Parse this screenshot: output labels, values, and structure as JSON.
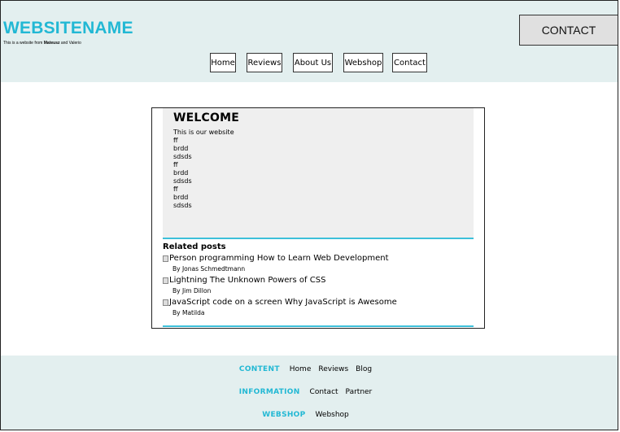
{
  "header": {
    "title": "WEBSITENAME",
    "subtitle_prefix": "This is a website from ",
    "subtitle_name1": "Mateusz",
    "subtitle_mid": " and ",
    "subtitle_name2": "Valerio",
    "contact_label": "CONTACT"
  },
  "nav": {
    "items": [
      "Home",
      "Reviews",
      "About Us",
      "Webshop",
      "Contact"
    ]
  },
  "welcome": {
    "heading": "WELCOME",
    "lines": [
      "This is our website",
      "ff",
      "brdd",
      "sdsds",
      "ff",
      "brdd",
      "sdsds",
      "ff",
      "brdd",
      "sdsds"
    ]
  },
  "related": {
    "heading": "Related posts",
    "posts": [
      {
        "title": "Person programming How to Learn Web Development",
        "author": "By Jonas Schmedtmann"
      },
      {
        "title": "Lightning The Unknown Powers of CSS",
        "author": "By Jim Dillon"
      },
      {
        "title": "JavaScript code on a screen Why JavaScript is Awesome",
        "author": "By Matilda"
      }
    ]
  },
  "footer": {
    "content_label": "CONTENT",
    "content_links": [
      "Home",
      "Reviews",
      "Blog"
    ],
    "information_label": "INFORMATION",
    "information_links": [
      "Contact",
      "Partner"
    ],
    "webshop_label": "WEBSHOP",
    "webshop_links": [
      "Webshop"
    ]
  },
  "colors": {
    "accent": "#22b8d4",
    "header_bg": "#e3efef",
    "welcome_bg": "#efefef",
    "divider": "#3dc0da"
  }
}
